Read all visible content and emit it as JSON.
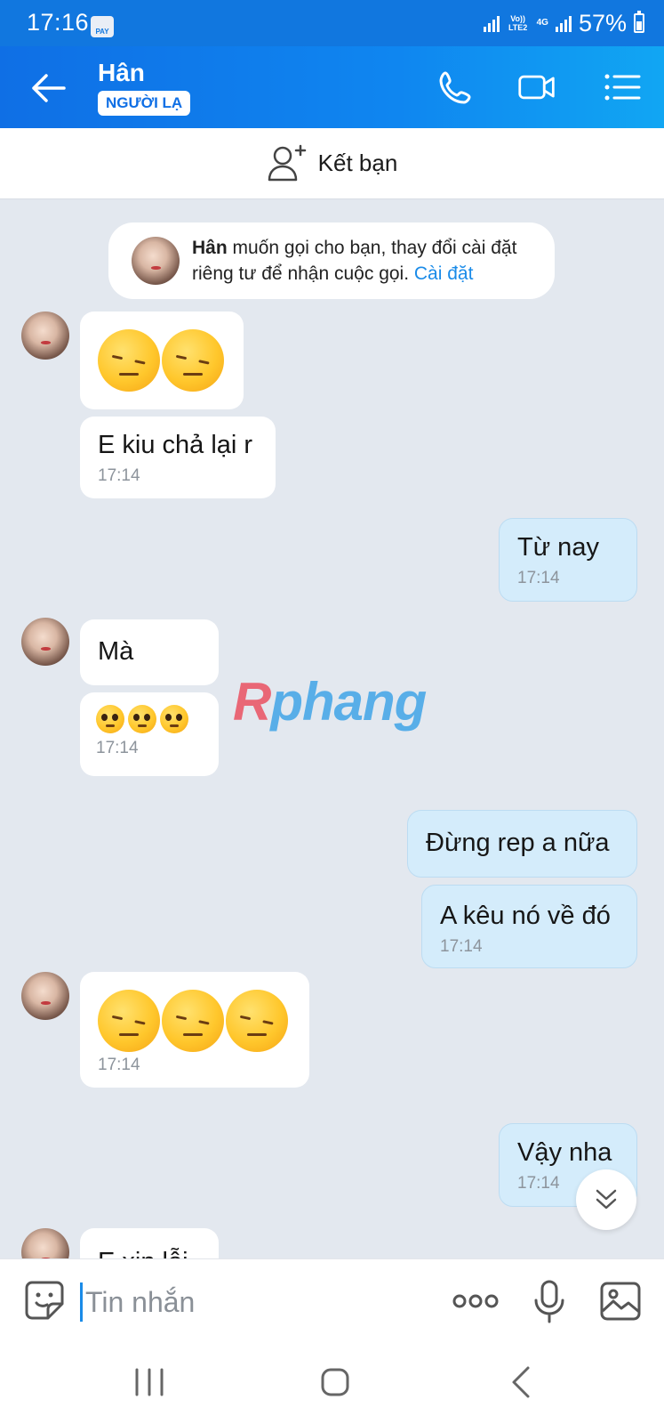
{
  "status_bar": {
    "time": "17:16",
    "pay_label": "PAY",
    "volte": "Vo)) LTE2",
    "network": "4G",
    "battery": "57%"
  },
  "header": {
    "contact_name": "Hân",
    "badge": "NGƯỜI LẠ"
  },
  "add_friend": {
    "label": "Kết bạn"
  },
  "call_notice": {
    "name": "Hân",
    "text": " muốn gọi cho bạn, thay đổi cài đặt riêng tư để nhận cuộc gọi. ",
    "link": "Cài đặt"
  },
  "messages": {
    "m2_text": "E kiu chả lại r",
    "m2_time": "17:14",
    "m3_text": "Từ nay",
    "m3_time": "17:14",
    "m4_text": "Mà",
    "m5_time": "17:14",
    "m6_text": "Đừng rep a nữa",
    "m7_text": "A kêu nó về đó",
    "m7_time": "17:14",
    "m8_time": "17:14",
    "m9_text": "Vậy nha",
    "m9_time": "17:14",
    "m10_text": "E xin lỗi"
  },
  "watermark": {
    "first": "R",
    "rest": "phang"
  },
  "input": {
    "placeholder": "Tin nhắn"
  },
  "colors": {
    "header": "#0f86f0",
    "accent": "#1a8be8",
    "outgoing_bubble": "#d4ecfb",
    "chat_bg": "#e3e8ef"
  }
}
